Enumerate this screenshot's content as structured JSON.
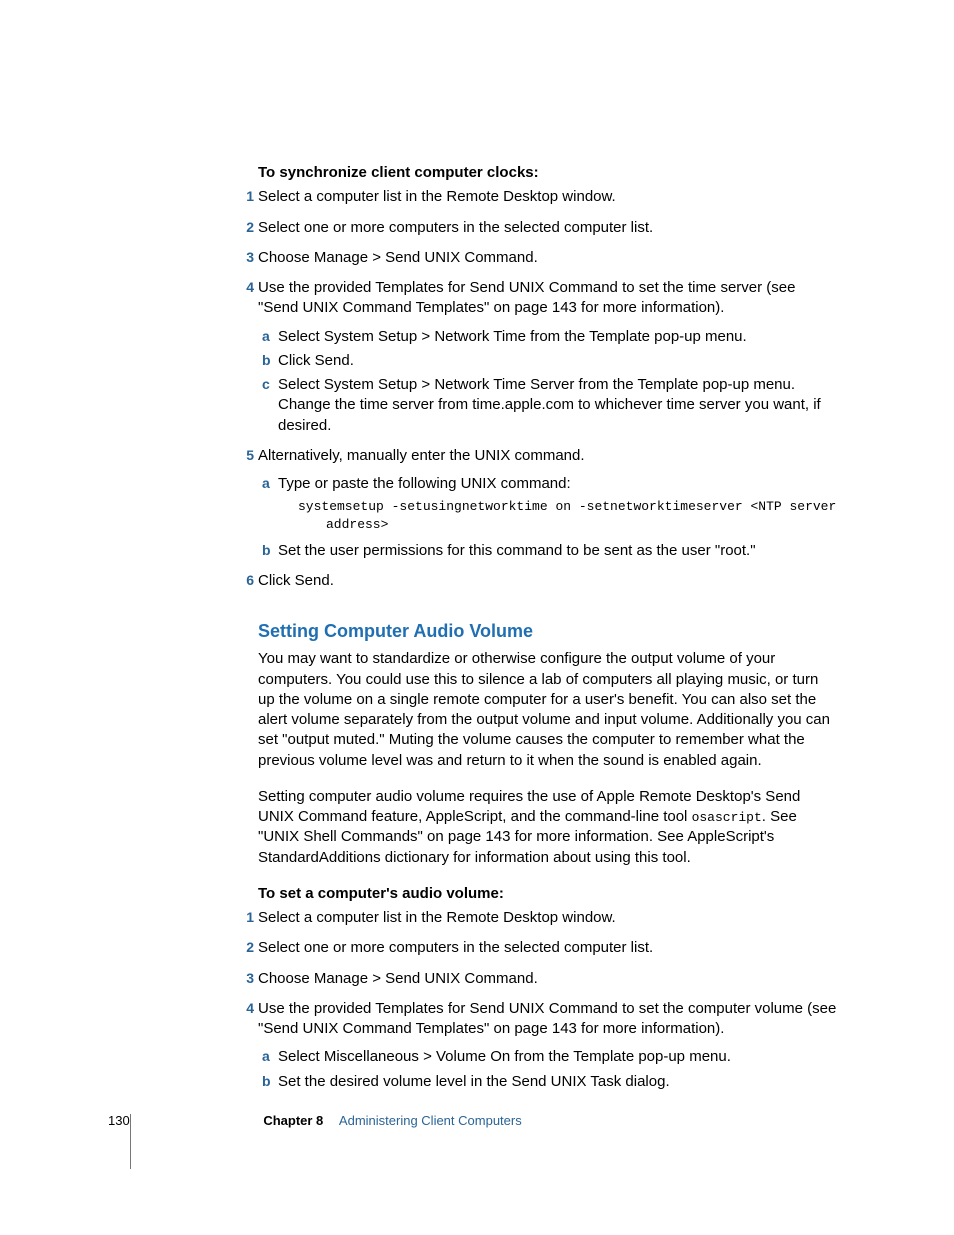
{
  "section1": {
    "leadIn": "To synchronize client computer clocks:",
    "steps": [
      {
        "n": "1",
        "text": "Select a computer list in the Remote Desktop window."
      },
      {
        "n": "2",
        "text": "Select one or more computers in the selected computer list."
      },
      {
        "n": "3",
        "text": "Choose Manage > Send UNIX Command."
      },
      {
        "n": "4",
        "text": "Use the provided Templates for Send UNIX Command to set the time server (see \"Send UNIX Command Templates\" on page 143 for more information).",
        "sub": [
          {
            "a": "a",
            "text": "Select System Setup > Network Time from the Template pop-up menu."
          },
          {
            "a": "b",
            "text": "Click Send."
          },
          {
            "a": "c",
            "text": "Select System Setup > Network Time Server from the Template pop-up menu. Change the time server from time.apple.com to whichever time server you want, if desired."
          }
        ]
      },
      {
        "n": "5",
        "text": "Alternatively, manually enter the UNIX command.",
        "sub": [
          {
            "a": "a",
            "text": "Type or paste the following UNIX command:"
          },
          {
            "a": "b",
            "text": "Set the user permissions for this command to be sent as the user \"root.\""
          }
        ],
        "code": {
          "l1": "systemsetup -setusingnetworktime on -setnetworktimeserver <NTP server",
          "l2": "address>"
        }
      },
      {
        "n": "6",
        "text": "Click Send."
      }
    ]
  },
  "section2": {
    "title": "Setting Computer Audio Volume",
    "para1": "You may want to standardize or otherwise configure the output volume of your computers. You could use this to silence a lab of computers all playing music, or turn up the volume on a single remote computer for a user's benefit. You can also set the alert volume separately from the output volume and input volume. Additionally you can set \"output muted.\" Muting the volume causes the computer to remember what the previous volume level was and return to it when the sound is enabled again.",
    "para2_a": "Setting computer audio volume requires the use of Apple Remote Desktop's Send UNIX Command feature, AppleScript, and the command-line tool ",
    "para2_code": "osascript",
    "para2_b": ". See \"UNIX Shell Commands\" on page 143 for more information. See AppleScript's StandardAdditions dictionary for information about using this tool.",
    "leadIn": "To set a computer's audio volume:",
    "steps": [
      {
        "n": "1",
        "text": "Select a computer list in the Remote Desktop window."
      },
      {
        "n": "2",
        "text": "Select one or more computers in the selected computer list."
      },
      {
        "n": "3",
        "text": "Choose Manage > Send UNIX Command."
      },
      {
        "n": "4",
        "text": "Use the provided Templates for Send UNIX Command to set the computer volume (see \"Send UNIX Command Templates\" on page 143 for more information).",
        "sub": [
          {
            "a": "a",
            "text": "Select Miscellaneous > Volume On from the Template pop-up menu."
          },
          {
            "a": "b",
            "text": "Set the desired volume level in the Send UNIX Task dialog."
          }
        ]
      }
    ]
  },
  "footer": {
    "pageNumber": "130",
    "chapterLabel": "Chapter 8",
    "chapterTitle": "Administering Client Computers"
  }
}
